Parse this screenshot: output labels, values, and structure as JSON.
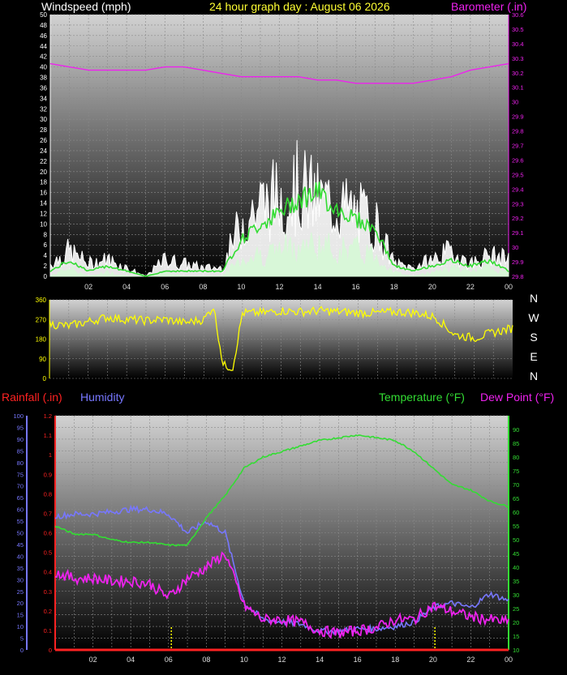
{
  "header": {
    "wind_title": "Windspeed (mph)",
    "graph_title": "24 hour graph day : August 06 2026",
    "baro_title": "Barometer (.in)"
  },
  "colors": {
    "wind": "#ffffff",
    "gust": "#ffffff",
    "wind_avg": "#33dd33",
    "wind_fill": "#d8f7d8",
    "baro": "#ee22ee",
    "dir": "#ffff00",
    "rain": "#ff2222",
    "humidity": "#7777ff",
    "temp": "#33dd33",
    "dew": "#ee22ee"
  },
  "x_ticks": [
    "02",
    "04",
    "06",
    "08",
    "10",
    "12",
    "14",
    "16",
    "18",
    "20",
    "22",
    "00"
  ],
  "compass": [
    "N",
    "W",
    "S",
    "E",
    "N"
  ],
  "chart_data": [
    {
      "type": "line",
      "title": "24 hour graph day : August 06 2026",
      "xlabel": "",
      "ylabel": "Windspeed (mph)",
      "y2label": "Barometer (.in)",
      "ylim": [
        0,
        50
      ],
      "y_ticks": [
        "0",
        "2",
        "4",
        "6",
        "8",
        "10",
        "12",
        "14",
        "16",
        "18",
        "20",
        "22",
        "24",
        "26",
        "28",
        "30",
        "32",
        "34",
        "36",
        "38",
        "40",
        "42",
        "44",
        "46",
        "48",
        "50"
      ],
      "y2lim": [
        29.8,
        30.6
      ],
      "y2_ticks": [
        "29.8",
        "29.9",
        "30",
        "29.1",
        "29.2",
        "29.3",
        "29.4",
        "29.5",
        "29.6",
        "29.7",
        "29.8",
        "29.9",
        "30",
        "30.1",
        "30.2",
        "30.3",
        "30.4",
        "30.5",
        "30.6"
      ],
      "grid": true,
      "x": [
        0,
        1,
        2,
        3,
        4,
        5,
        6,
        7,
        8,
        9,
        10,
        11,
        12,
        13,
        14,
        15,
        16,
        17,
        18,
        19,
        20,
        21,
        22,
        23,
        24
      ],
      "series": [
        {
          "name": "Windspeed (mph)",
          "kind": "gust",
          "values": [
            3,
            6,
            3,
            4,
            2,
            0,
            4,
            3,
            2,
            2,
            13,
            17,
            19,
            21,
            18,
            17,
            15,
            13,
            3,
            2,
            4,
            6,
            3,
            5,
            4
          ]
        },
        {
          "name": "Windspeed (mph)",
          "kind": "avg",
          "values": [
            1,
            3,
            1,
            2,
            1,
            0,
            1,
            1,
            1,
            1,
            7,
            10,
            12,
            15,
            16,
            13,
            11,
            9,
            2,
            1,
            2,
            3,
            2,
            3,
            1
          ]
        },
        {
          "name": "Windspeed (mph)",
          "kind": "speed",
          "values": [
            0,
            2,
            0,
            1,
            0,
            0,
            1,
            0,
            0,
            0,
            4,
            5,
            6,
            7,
            7,
            6,
            6,
            5,
            1,
            0,
            1,
            2,
            1,
            2,
            1
          ]
        },
        {
          "name": "Barometer (.in)",
          "axis": "right",
          "values": [
            30.45,
            30.44,
            30.43,
            30.43,
            30.43,
            30.43,
            30.44,
            30.44,
            30.43,
            30.42,
            30.41,
            30.41,
            30.41,
            30.41,
            30.4,
            30.4,
            30.39,
            30.39,
            30.39,
            30.39,
            30.4,
            30.41,
            30.43,
            30.44,
            30.45
          ]
        }
      ]
    },
    {
      "type": "line",
      "title": "",
      "ylabel": "",
      "ylim": [
        0,
        360
      ],
      "y_ticks": [
        "0",
        "90",
        "180",
        "270",
        "360"
      ],
      "grid": true,
      "x": [
        0,
        1,
        2,
        3,
        4,
        5,
        6,
        7,
        8,
        8.5,
        9,
        9.5,
        10,
        11,
        12,
        13,
        14,
        15,
        16,
        17,
        18,
        19,
        20,
        21,
        22,
        23,
        24
      ],
      "series": [
        {
          "name": "Wind direction",
          "values": [
            250,
            240,
            260,
            280,
            270,
            265,
            270,
            255,
            270,
            330,
            60,
            50,
            300,
            300,
            310,
            305,
            310,
            305,
            300,
            300,
            305,
            300,
            280,
            200,
            185,
            210,
            230
          ]
        }
      ]
    },
    {
      "type": "line",
      "title": "",
      "ylabels": [
        "Rainfall (.in)",
        "Humidity"
      ],
      "y2label": "Temperature (°F) Dew Point (°F)",
      "rain_lim": [
        0,
        1.2
      ],
      "rain_ticks": [
        "0",
        "0.1",
        "0.2",
        "0.3",
        "0.4",
        "0.5",
        "0.6",
        "0.7",
        "0.8",
        "0.9",
        "1",
        "1.1",
        "1.2"
      ],
      "humidity_lim": [
        0,
        100
      ],
      "humidity_ticks": [
        "0",
        "5",
        "10",
        "15",
        "20",
        "25",
        "30",
        "35",
        "40",
        "45",
        "50",
        "55",
        "60",
        "65",
        "70",
        "75",
        "80",
        "85",
        "90",
        "95",
        "100"
      ],
      "temp_lim": [
        10,
        95
      ],
      "temp_ticks": [
        "10",
        "15",
        "20",
        "25",
        "30",
        "35",
        "40",
        "45",
        "50",
        "55",
        "60",
        "65",
        "70",
        "75",
        "80",
        "85",
        "90"
      ],
      "grid": true,
      "x": [
        0,
        1,
        2,
        3,
        4,
        5,
        6,
        7,
        8,
        9,
        10,
        11,
        12,
        13,
        14,
        15,
        16,
        17,
        18,
        19,
        20,
        21,
        22,
        23,
        24
      ],
      "series": [
        {
          "name": "Humidity",
          "axis": "humidity",
          "values": [
            57,
            58,
            58,
            59,
            60,
            60,
            58,
            50,
            55,
            50,
            20,
            13,
            12,
            11,
            8,
            8,
            9,
            9,
            10,
            12,
            18,
            20,
            18,
            24,
            21
          ]
        },
        {
          "name": "Temperature (°F)",
          "axis": "temp",
          "values": [
            55,
            52,
            52,
            50,
            49,
            49,
            48,
            48,
            58,
            66,
            76,
            80,
            82,
            84,
            86,
            87,
            88,
            87,
            86,
            82,
            76,
            70,
            68,
            64,
            62
          ]
        },
        {
          "name": "Dew Point (°F)",
          "axis": "temp",
          "values": [
            38,
            36,
            36,
            35,
            35,
            34,
            29,
            36,
            40,
            45,
            26,
            21,
            21,
            20,
            17,
            16,
            17,
            18,
            21,
            21,
            26,
            24,
            22,
            21,
            20
          ]
        },
        {
          "name": "Rainfall (.in)",
          "axis": "rain",
          "values": [
            0,
            0,
            0,
            0,
            0,
            0,
            0,
            0,
            0,
            0,
            0,
            0,
            0,
            0,
            0,
            0,
            0,
            0,
            0,
            0,
            0,
            0,
            0,
            0,
            0
          ]
        }
      ]
    }
  ]
}
